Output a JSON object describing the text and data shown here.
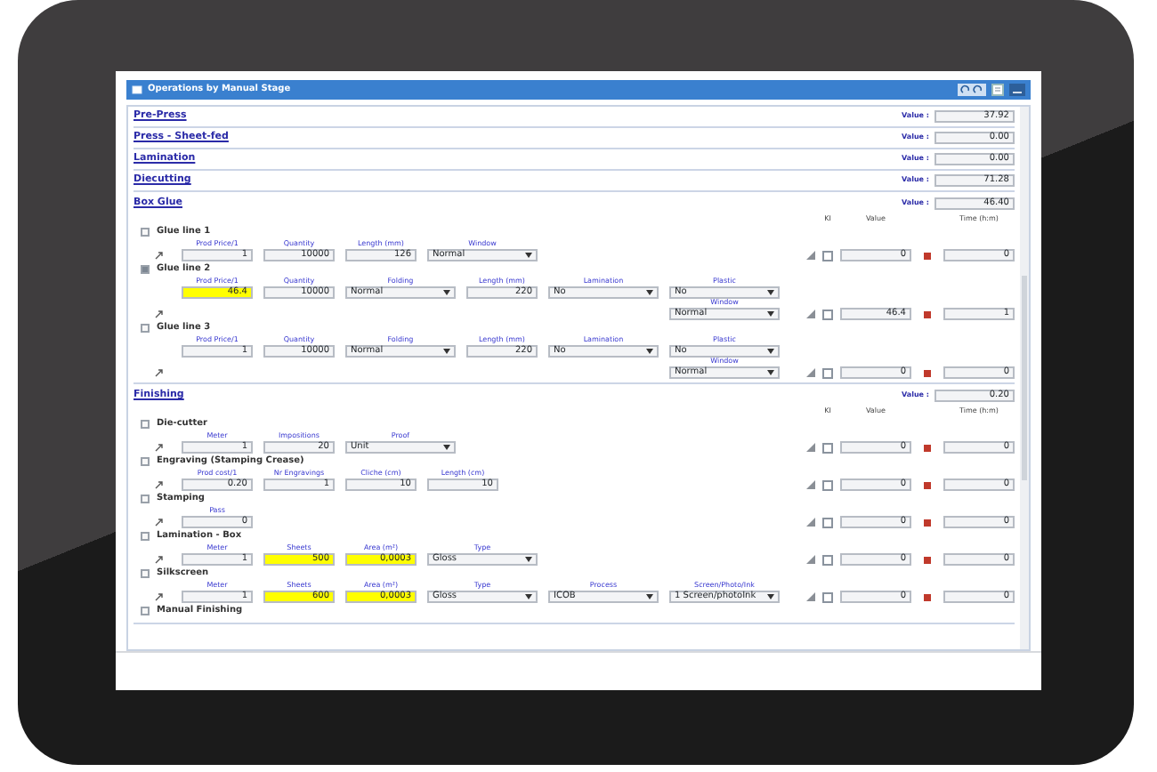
{
  "window": {
    "title": "Operations by Manual Stage"
  },
  "sections": [
    {
      "title": "Pre-Press",
      "value_label": "Value :",
      "value": "37.92"
    },
    {
      "title": "Press - Sheet-fed",
      "value_label": "Value :",
      "value": "0.00"
    },
    {
      "title": "Lamination",
      "value_label": "Value :",
      "value": "0.00"
    },
    {
      "title": "Diecutting",
      "value_label": "Value :",
      "value": "71.28"
    },
    {
      "title": "Box Glue",
      "value_label": "Value :",
      "value": "46.40",
      "columns": [
        "KI",
        "Value",
        "Time (h:m)"
      ],
      "items": [
        {
          "name": "Glue line 1",
          "checked": false,
          "ki": false,
          "value": "0",
          "time": "0",
          "fields": [
            {
              "kind": "input",
              "label": "Prod Price/1",
              "value": "1",
              "highlighted": false
            },
            {
              "kind": "input",
              "label": "Quantity",
              "value": "10000",
              "highlighted": false
            },
            {
              "kind": "input",
              "label": "Length (mm)",
              "value": "126",
              "highlighted": false
            },
            {
              "kind": "select",
              "label": "Window",
              "value": "Normal"
            }
          ]
        },
        {
          "name": "Glue line 2",
          "checked": true,
          "ki": false,
          "value": "46.4",
          "time": "1",
          "fields": [
            {
              "kind": "input",
              "label": "Prod Price/1",
              "value": "46.4",
              "highlighted": true
            },
            {
              "kind": "input",
              "label": "Quantity",
              "value": "10000",
              "highlighted": false
            },
            {
              "kind": "select",
              "label": "Folding",
              "value": "Normal"
            },
            {
              "kind": "input",
              "label": "Length (mm)",
              "value": "220",
              "highlighted": false
            },
            {
              "kind": "select",
              "label": "Lamination",
              "value": "No"
            },
            {
              "kind": "select",
              "label": "Plastic",
              "value": "No"
            }
          ],
          "sub_field": {
            "kind": "select",
            "label": "Window",
            "value": "Normal"
          }
        },
        {
          "name": "Glue line 3",
          "checked": false,
          "ki": false,
          "value": "0",
          "time": "0",
          "fields": [
            {
              "kind": "input",
              "label": "Prod Price/1",
              "value": "1",
              "highlighted": false
            },
            {
              "kind": "input",
              "label": "Quantity",
              "value": "10000",
              "highlighted": false
            },
            {
              "kind": "select",
              "label": "Folding",
              "value": "Normal"
            },
            {
              "kind": "input",
              "label": "Length (mm)",
              "value": "220",
              "highlighted": false
            },
            {
              "kind": "select",
              "label": "Lamination",
              "value": "No"
            },
            {
              "kind": "select",
              "label": "Plastic",
              "value": "No"
            }
          ],
          "sub_field": {
            "kind": "select",
            "label": "Window",
            "value": "Normal"
          }
        }
      ]
    },
    {
      "title": "Finishing",
      "value_label": "Value :",
      "value": "0.20",
      "columns": [
        "KI",
        "Value",
        "Time (h:m)"
      ],
      "items": [
        {
          "name": "Die-cutter",
          "checked": false,
          "ki": false,
          "value": "0",
          "time": "0",
          "fields": [
            {
              "kind": "input",
              "label": "Meter",
              "value": "1",
              "highlighted": false
            },
            {
              "kind": "input",
              "label": "Impositions",
              "value": "20",
              "highlighted": false
            },
            {
              "kind": "select",
              "label": "Proof",
              "value": "Unit"
            }
          ]
        },
        {
          "name": "Engraving (Stamping Crease)",
          "checked": false,
          "ki": false,
          "value": "0",
          "time": "0",
          "fields": [
            {
              "kind": "input",
              "label": "Prod cost/1",
              "value": "0.20",
              "highlighted": false
            },
            {
              "kind": "input",
              "label": "Nr Engravings",
              "value": "1",
              "highlighted": false
            },
            {
              "kind": "input",
              "label": "Cliche (cm)",
              "value": "10",
              "highlighted": false
            },
            {
              "kind": "input",
              "label": "Length (cm)",
              "value": "10",
              "highlighted": false
            }
          ]
        },
        {
          "name": "Stamping",
          "checked": false,
          "ki": false,
          "value": "0",
          "time": "0",
          "fields": [
            {
              "kind": "input",
              "label": "Pass",
              "value": "0",
              "highlighted": false
            }
          ]
        },
        {
          "name": "Lamination - Box",
          "checked": false,
          "ki": false,
          "value": "0",
          "time": "0",
          "fields": [
            {
              "kind": "input",
              "label": "Meter",
              "value": "1",
              "highlighted": false
            },
            {
              "kind": "input",
              "label": "Sheets",
              "value": "500",
              "highlighted": true
            },
            {
              "kind": "input",
              "label": "Area (m²)",
              "value": "0,0003",
              "highlighted": true
            },
            {
              "kind": "select",
              "label": "Type",
              "value": "Gloss"
            }
          ]
        },
        {
          "name": "Silkscreen",
          "checked": false,
          "ki": false,
          "value": "0",
          "time": "0",
          "fields": [
            {
              "kind": "input",
              "label": "Meter",
              "value": "1",
              "highlighted": false
            },
            {
              "kind": "input",
              "label": "Sheets",
              "value": "600",
              "highlighted": true
            },
            {
              "kind": "input",
              "label": "Area (m²)",
              "value": "0,0003",
              "highlighted": true
            },
            {
              "kind": "select",
              "label": "Type",
              "value": "Gloss"
            },
            {
              "kind": "select",
              "label": "Process",
              "value": "ICOB"
            },
            {
              "kind": "select",
              "label": "Screen/Photo/Ink",
              "value": "1 Screen/photoInk"
            }
          ]
        },
        {
          "name": "Manual Finishing",
          "checked": false
        }
      ]
    }
  ]
}
